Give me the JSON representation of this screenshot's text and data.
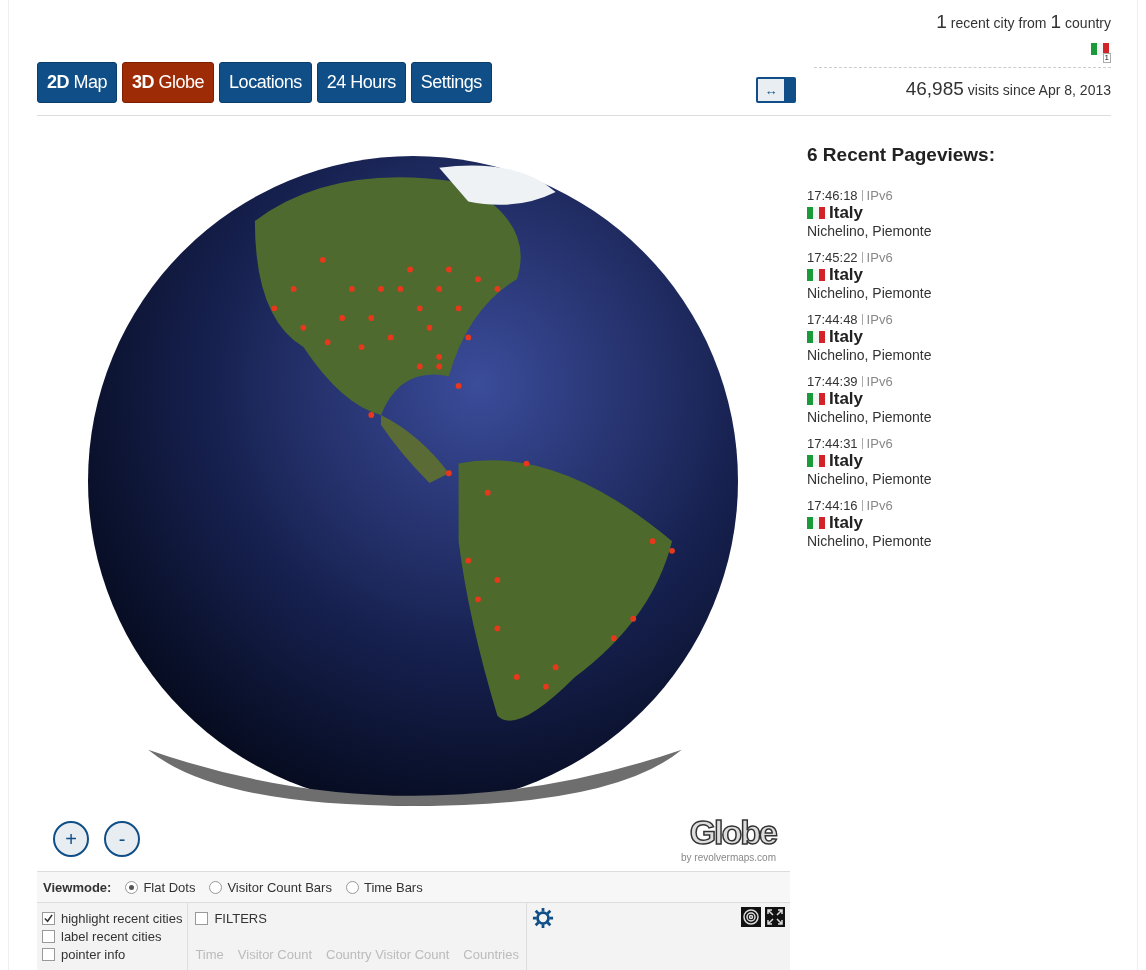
{
  "summary": {
    "cities": "1",
    "cities_label": "recent city from",
    "countries": "1",
    "countries_label": "country",
    "flag_count": "1",
    "visits": "46,985",
    "visits_label": "visits since Apr 8, 2013"
  },
  "tabs": [
    {
      "label": "**2D** Map",
      "selected": false
    },
    {
      "label": "**3D** Globe",
      "selected": true
    },
    {
      "label": "Locations",
      "selected": false
    },
    {
      "label": "24 Hours",
      "selected": false
    },
    {
      "label": "Settings",
      "selected": false
    }
  ],
  "expand_button": {
    "label": "↔"
  },
  "map": {
    "zoom_in": "+",
    "zoom_out": "-",
    "logo": "Globe",
    "credit": "by revolvermaps.com"
  },
  "viewmode": {
    "label": "Viewmode:",
    "options": [
      {
        "label": "Flat Dots",
        "selected": true
      },
      {
        "label": "Visitor Count Bars",
        "selected": false
      },
      {
        "label": "Time Bars",
        "selected": false
      }
    ]
  },
  "options": [
    {
      "label": "highlight recent cities",
      "checked": true
    },
    {
      "label": "label recent cities",
      "checked": false
    },
    {
      "label": "pointer info",
      "checked": false
    }
  ],
  "filters": {
    "label": "FILTERS",
    "checked": false,
    "columns": [
      "Time",
      "Visitor Count",
      "Country Visitor Count",
      "Countries"
    ]
  },
  "recent": {
    "title": "6 Recent Pageviews:",
    "items": [
      {
        "time": "17:46:18",
        "ip": "IPv6",
        "country": "Italy",
        "place": "Nichelino, Piemonte"
      },
      {
        "time": "17:45:22",
        "ip": "IPv6",
        "country": "Italy",
        "place": "Nichelino, Piemonte"
      },
      {
        "time": "17:44:48",
        "ip": "IPv6",
        "country": "Italy",
        "place": "Nichelino, Piemonte"
      },
      {
        "time": "17:44:39",
        "ip": "IPv6",
        "country": "Italy",
        "place": "Nichelino, Piemonte"
      },
      {
        "time": "17:44:31",
        "ip": "IPv6",
        "country": "Italy",
        "place": "Nichelino, Piemonte"
      },
      {
        "time": "17:44:16",
        "ip": "IPv6",
        "country": "Italy",
        "place": "Nichelino, Piemonte"
      }
    ]
  }
}
